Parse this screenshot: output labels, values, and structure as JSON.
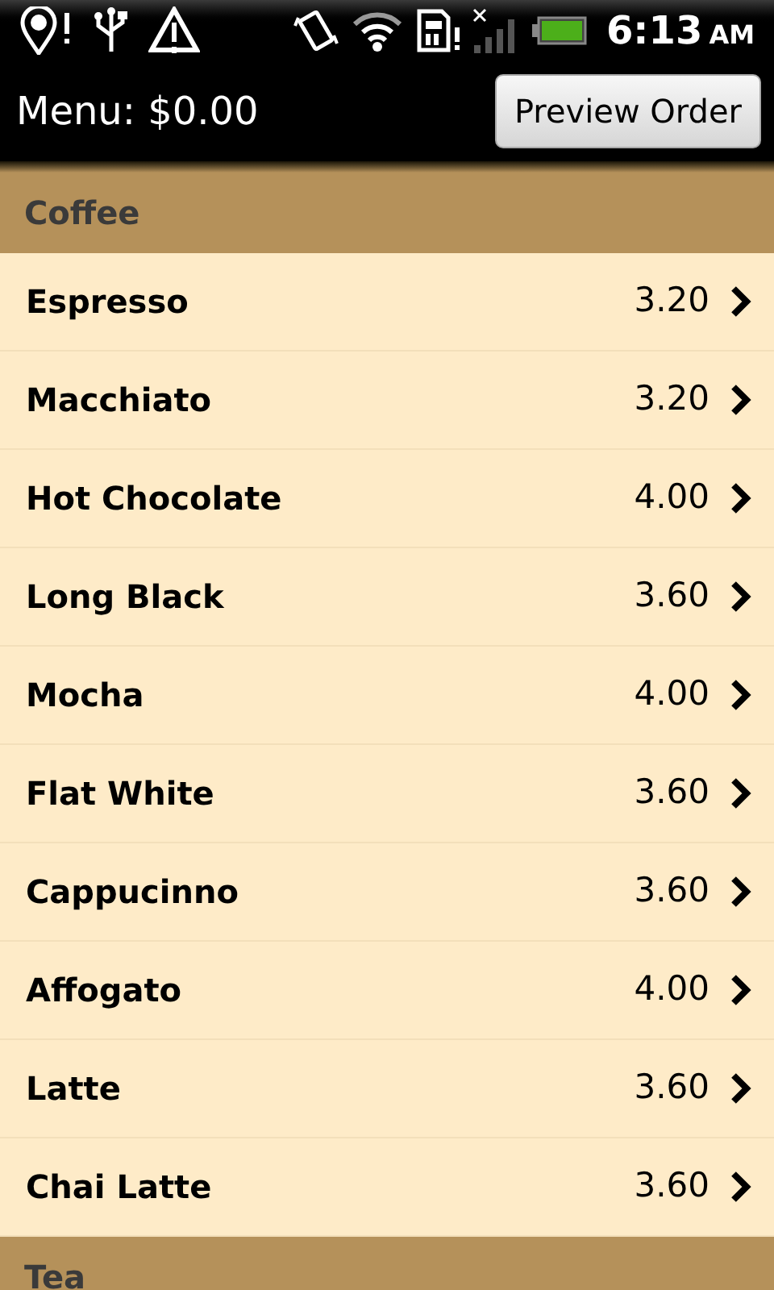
{
  "status_bar": {
    "time": "6:13",
    "meridiem": "AM"
  },
  "header": {
    "title": "Menu: $0.00",
    "button": "Preview Order"
  },
  "sections": [
    {
      "title": "Coffee",
      "items": [
        {
          "name": "Espresso",
          "price": "3.20"
        },
        {
          "name": "Macchiato",
          "price": "3.20"
        },
        {
          "name": "Hot Chocolate",
          "price": "4.00"
        },
        {
          "name": "Long Black",
          "price": "3.60"
        },
        {
          "name": "Mocha",
          "price": "4.00"
        },
        {
          "name": "Flat White",
          "price": "3.60"
        },
        {
          "name": "Cappucinno",
          "price": "3.60"
        },
        {
          "name": "Affogato",
          "price": "4.00"
        },
        {
          "name": "Latte",
          "price": "3.60"
        },
        {
          "name": "Chai Latte",
          "price": "3.60"
        }
      ]
    },
    {
      "title": "Tea"
    }
  ]
}
